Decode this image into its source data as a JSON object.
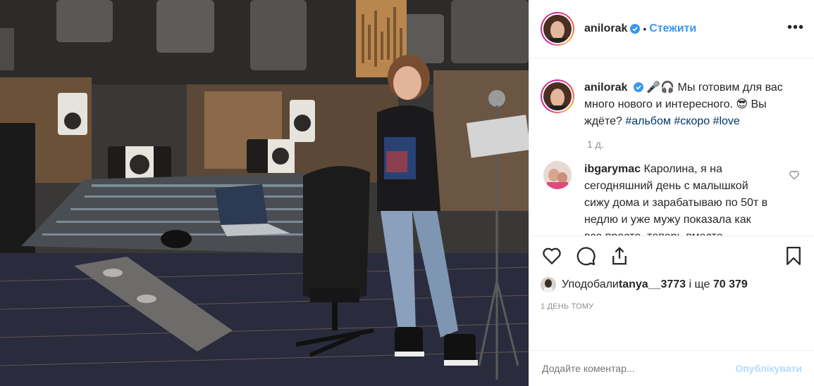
{
  "post": {
    "username": "anilorak",
    "follow_label": "Стежити",
    "more_label": "•••",
    "separator": "•"
  },
  "caption": {
    "username": "anilorak",
    "emoji_prefix": "🎤🎧",
    "text": " Мы готовим для вас много нового и интересного. 😎 Вы ждёте? ",
    "tags": [
      "#альбом",
      "#скоро",
      "#love"
    ],
    "age": "1 д."
  },
  "comments": [
    {
      "username": "ibgarymac",
      "text": " Каролина, я на сегодняшний день с малышкой сижу дома и зарабатываю по 50т в недлю и уже мужу показала как все просто, теперь вместе рабтаем. там главное чтоб в"
    }
  ],
  "likes": {
    "prefix": "Уподобали ",
    "user": "tanya__3773",
    "middle": " і ще ",
    "count": "70 379"
  },
  "timestamp": "1 ДЕНЬ ТОМУ",
  "add_comment": {
    "placeholder": "Додайте коментар...",
    "publish_label": "Опублікувати"
  },
  "colors": {
    "link": "#3897f0",
    "hashtag": "#003569",
    "muted": "#8e8e8e",
    "publish_disabled": "#b3dbff"
  },
  "icons": [
    "heart-icon",
    "comment-icon",
    "share-icon",
    "bookmark-icon",
    "verified-icon",
    "small-heart-icon"
  ]
}
